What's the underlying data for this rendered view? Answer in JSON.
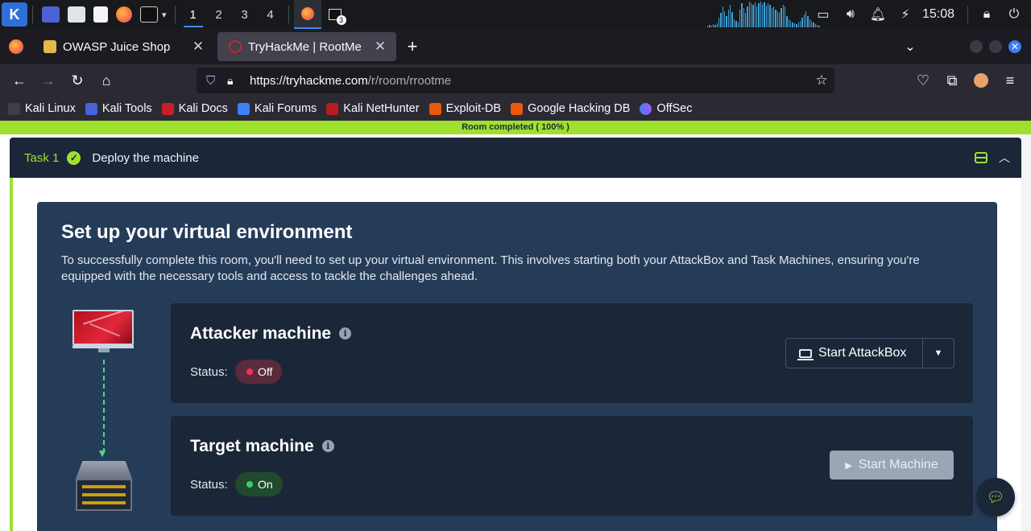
{
  "panel": {
    "workspaces": [
      "1",
      "2",
      "3",
      "4"
    ],
    "active_workspace": "1",
    "terminal_badge": "3",
    "clock": "15:08",
    "cpu_graph": [
      2,
      3,
      2,
      4,
      3,
      5,
      12,
      18,
      26,
      20,
      14,
      22,
      28,
      19,
      10,
      8,
      6,
      22,
      30,
      24,
      18,
      26,
      32,
      30,
      28,
      31,
      26,
      30,
      32,
      29,
      31,
      27,
      30,
      28,
      24,
      26,
      22,
      20,
      18,
      24,
      28,
      26,
      14,
      10,
      8,
      6,
      5,
      4,
      6,
      8,
      12,
      16,
      20,
      14,
      10,
      8,
      6,
      4,
      3,
      2
    ]
  },
  "browser": {
    "tabs": [
      {
        "title": "OWASP Juice Shop",
        "active": false
      },
      {
        "title": "TryHackMe | RootMe",
        "active": true
      }
    ],
    "url_host": "https://tryhackme.com",
    "url_path": "/r/room/rrootme",
    "bookmarks": [
      "Kali Linux",
      "Kali Tools",
      "Kali Docs",
      "Kali Forums",
      "Kali NetHunter",
      "Exploit-DB",
      "Google Hacking DB",
      "OffSec"
    ],
    "colors": {
      "accent": "#3d7cf5"
    }
  },
  "page": {
    "progress_text": "Room completed ( 100% )",
    "progress_percent": 100,
    "task": {
      "number": "Task 1",
      "title": "Deploy the machine",
      "completed": true
    },
    "env": {
      "title": "Set up your virtual environment",
      "description": "To successfully complete this room, you'll need to set up your virtual environment. This involves starting both your AttackBox and Task Machines, ensuring you're equipped with the necessary tools and access to tackle the challenges ahead."
    },
    "attacker": {
      "title": "Attacker machine",
      "status_label": "Status:",
      "status": "Off",
      "button": "Start AttackBox"
    },
    "target": {
      "title": "Target machine",
      "status_label": "Status:",
      "status": "On",
      "button": "Start Machine"
    },
    "colors": {
      "brand_green": "#9fe02e",
      "card_bg": "#253c59",
      "machine_bg": "#1b2638",
      "off_red": "#ff2d55",
      "on_green": "#38d26a"
    }
  }
}
